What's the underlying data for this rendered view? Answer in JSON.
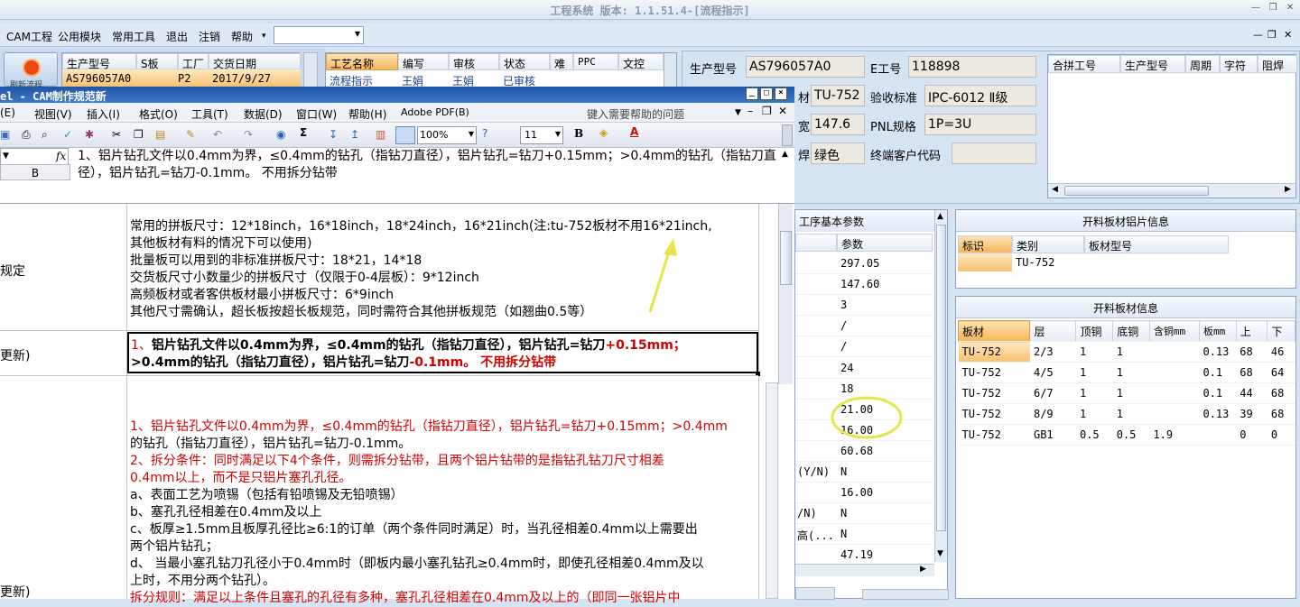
{
  "app": {
    "title": "工程系统 版本: 1.1.51.4-[流程指示]",
    "window_controls": [
      "—",
      "❐",
      "✕"
    ],
    "mdi_controls": [
      "—",
      "❐",
      "✕"
    ]
  },
  "menu": {
    "items": [
      "CAM工程",
      "公用模块",
      "常用工具",
      "退出",
      "注销",
      "帮助"
    ],
    "combo_value": ""
  },
  "left_top_grid": {
    "headers": [
      "生产型号",
      "S板",
      "工厂",
      "交货日期"
    ],
    "row": [
      "AS796057A0",
      "",
      "P2",
      "2017/9/27"
    ],
    "button_label": "刷新流程"
  },
  "process_grid": {
    "headers": [
      "工艺名称",
      "编写",
      "审核",
      "状态",
      "难",
      "PPC",
      "文控"
    ],
    "row": [
      "流程指示",
      "王娟",
      "王娟",
      "已审核",
      "",
      "",
      ""
    ]
  },
  "info": {
    "labels": {
      "model": "生产型号",
      "e_no": "E工号",
      "material": "材",
      "accept": "验收标准",
      "width": "宽",
      "pnl": "PNL规格",
      "mask": "焊",
      "customer": "终端客户代码"
    },
    "values": {
      "model": "AS796057A0",
      "e_no": "118898",
      "material": "TU-752",
      "accept": "IPC-6012 Ⅱ级",
      "width": "147.6",
      "pnl": "1P=3U",
      "mask": "绿色",
      "customer": ""
    }
  },
  "merge_grid": {
    "headers": [
      "合拼工号",
      "生产型号",
      "周期",
      "字符",
      "阻焊"
    ]
  },
  "excel": {
    "title": "el - CAM制作规范新",
    "menu": [
      "(E)",
      "视图(V)",
      "插入(I)",
      "格式(O)",
      "工具(T)",
      "数据(D)",
      "窗口(W)",
      "帮助(H)",
      "Adobe PDF(B)"
    ],
    "help_placeholder": "键入需要帮助的问题",
    "zoom": "100%",
    "font_size": "11",
    "namebox": "",
    "fx": "fx",
    "formula": "1、铝片钻孔文件以0.4mm为界，≤0.4mm的钻孔（指钻刀直径），铝片钻孔=钻刀+0.15mm；>0.4mm的钻孔（指钻刀直径），铝片钻孔=钻刀-0.1mm。    不用拆分钻带",
    "col_b": "B",
    "row_labels": [
      "规定",
      "更新)",
      "更新)"
    ],
    "cell1": [
      "常用的拼板尺寸：12*18inch，16*18inch，18*24inch，16*21inch(注:tu-752板材不用16*21inch,",
      "其他板材有料的情况下可以使用)",
      "批量板可以用到的非标准拼板尺寸：18*21，14*18",
      "交货板尺寸小数量少的拼板尺寸（仅限于0-4层板）：9*12inch",
      "高频板材或者客供板材最小拼板尺寸：6*9inch",
      "其他尺寸需确认，超长板按超长板规范，同时需符合其他拼板规范（如翘曲0.5等）"
    ],
    "cell2_a": "1、",
    "cell2_b": "铝片钻孔文件以0.4mm为界，≤0.4mm的钻孔（指钻刀直径），铝片钻孔=钻刀",
    "cell2_c": "+0.15mm；",
    "cell2_d": ">0.4mm的钻孔（指钻刀直径），铝片钻孔=钻刀",
    "cell2_e": "-0.1mm。",
    "cell2_f": "    不用拆分钻带",
    "cell3": [
      {
        "t": "1、铝片钻孔文件以0.4mm为界，≤0.4mm的钻孔（指钻刀直径），铝片钻孔=钻刀+0.15mm；>0.4mm",
        "c": "mixed1"
      },
      {
        "t": "的钻孔（指钻刀直径），铝片钻孔=钻刀-0.1mm。",
        "c": "black"
      },
      {
        "t": "2、拆分条件：同时满足以下4个条件，则需拆分钻带，且两个铝片钻带的是指钻孔钻刀尺寸相差",
        "c": "red"
      },
      {
        "t": "0.4mm以上，而不是只铝片塞孔孔径。",
        "c": "red"
      },
      {
        "t": "a、表面工艺为喷锡（包括有铅喷锡及无铅喷锡）",
        "c": "black"
      },
      {
        "t": "b、塞孔孔径相差在0.4mm及以上",
        "c": "black"
      },
      {
        "t": "c、板厚≥1.5mm且板厚孔径比≥6:1的订单（两个条件同时满足）时，当孔径相差0.4mm以上需要出",
        "c": "black"
      },
      {
        "t": "两个铝片钻孔；",
        "c": "black"
      },
      {
        "t": "d、  当最小塞孔钻刀孔径小于0.4mm时（即板内最小塞孔钻孔≥0.4mm时，即使孔径相差0.4mm及以",
        "c": "black"
      },
      {
        "t": "上时，不用分两个钻孔）。",
        "c": "black"
      },
      {
        "t": "拆分规则：满足以上条件且塞孔的孔径有多种，塞孔孔径相差在0.4mm及以上的（即同一张铝片中",
        "c": "red"
      }
    ]
  },
  "params": {
    "title": "工序基本参数",
    "header": "参数",
    "labels": [
      "",
      "",
      "",
      "",
      "",
      "",
      "",
      "",
      "",
      "",
      "(Y/N)",
      "",
      "/N)",
      "高(...",
      ""
    ],
    "values": [
      "297.05",
      "147.60",
      "3",
      "/",
      "/",
      "24",
      "18",
      "21.00",
      "16.00",
      "60.68",
      "N",
      "16.00",
      "N",
      "N",
      "47.19"
    ]
  },
  "al_panel": {
    "title": "开料板材铝片信息",
    "headers": [
      "标识",
      "类别",
      "板材型号"
    ],
    "row": [
      "",
      "TU-752",
      ""
    ]
  },
  "board_panel": {
    "title": "开料板材信息",
    "headers": [
      "板材",
      "层",
      "顶铜",
      "底铜",
      "含铜mm",
      "板mm",
      "上",
      "下"
    ],
    "rows": [
      [
        "TU-752",
        "2/3",
        "1",
        "1",
        "",
        "0.13",
        "68",
        "46"
      ],
      [
        "TU-752",
        "4/5",
        "1",
        "1",
        "",
        "0.1",
        "68",
        "64"
      ],
      [
        "TU-752",
        "6/7",
        "1",
        "1",
        "",
        "0.1",
        "44",
        "68"
      ],
      [
        "TU-752",
        "8/9",
        "1",
        "1",
        "",
        "0.13",
        "39",
        "68"
      ],
      [
        "TU-752",
        "GB1",
        "0.5",
        "0.5",
        "1.9",
        "",
        "0",
        "0"
      ]
    ]
  },
  "colors": {
    "accent_orange": "#f5b55a",
    "annotation_yellow": "#e6e64a",
    "text_red": "#d00000",
    "excel_title_blue": "#2a62b0"
  }
}
